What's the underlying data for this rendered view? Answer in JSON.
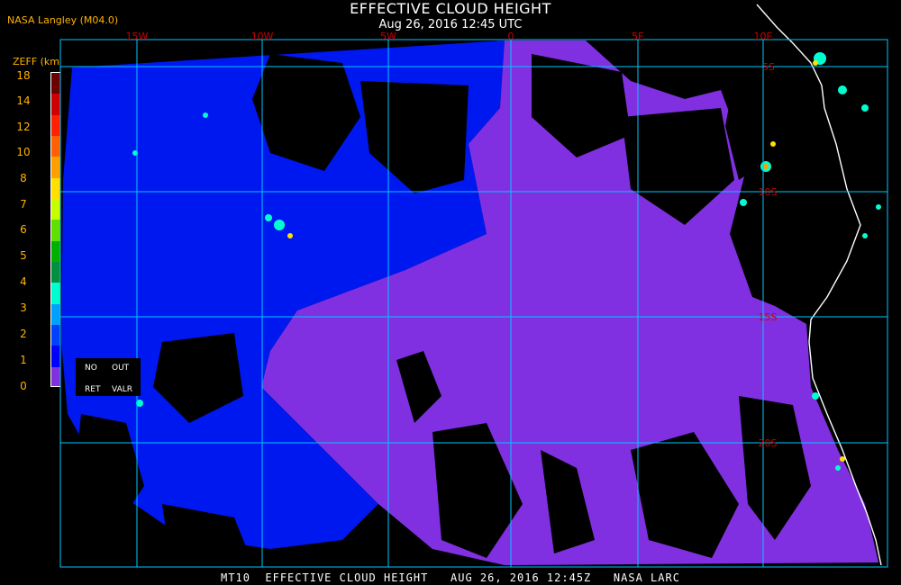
{
  "header": {
    "title": "EFFECTIVE CLOUD HEIGHT",
    "subtitle": "Aug 26, 2016 12:45 UTC",
    "credit": "NASA Langley (M04.0)"
  },
  "legend": {
    "units": "ZEFF (km)",
    "ticks": [
      "18",
      "14",
      "12",
      "10",
      "8",
      "7",
      "6",
      "5",
      "4",
      "3",
      "2",
      "1",
      "0"
    ],
    "colors": [
      "#6a0000",
      "#cc0000",
      "#ff2000",
      "#ff6000",
      "#ffa000",
      "#ffe000",
      "#c8ff00",
      "#60e000",
      "#00b000",
      "#009040",
      "#00ffd0",
      "#00a0ff",
      "#0040ff",
      "#0000ff",
      "#8030e0"
    ],
    "flags": {
      "no_ret": [
        "NO",
        "RET"
      ],
      "out_valr": [
        "OUT",
        "VALR"
      ]
    }
  },
  "map": {
    "lon_labels": [
      "15W",
      "10W",
      "5W",
      "0",
      "5E",
      "10E"
    ],
    "lat_labels": [
      "5S",
      "10S",
      "15S",
      "20S"
    ],
    "colors": {
      "background": "#000000",
      "grid": "#00c8ff",
      "coast": "#ffffff",
      "low_cloud": "#8030e0",
      "mid_cloud": "#0018f0",
      "high_cloud": "#00ffd0",
      "label": "#cc0000"
    }
  },
  "footer": {
    "text": "MT10  EFFECTIVE CLOUD HEIGHT   AUG 26, 2016 12:45Z   NASA LARC"
  }
}
